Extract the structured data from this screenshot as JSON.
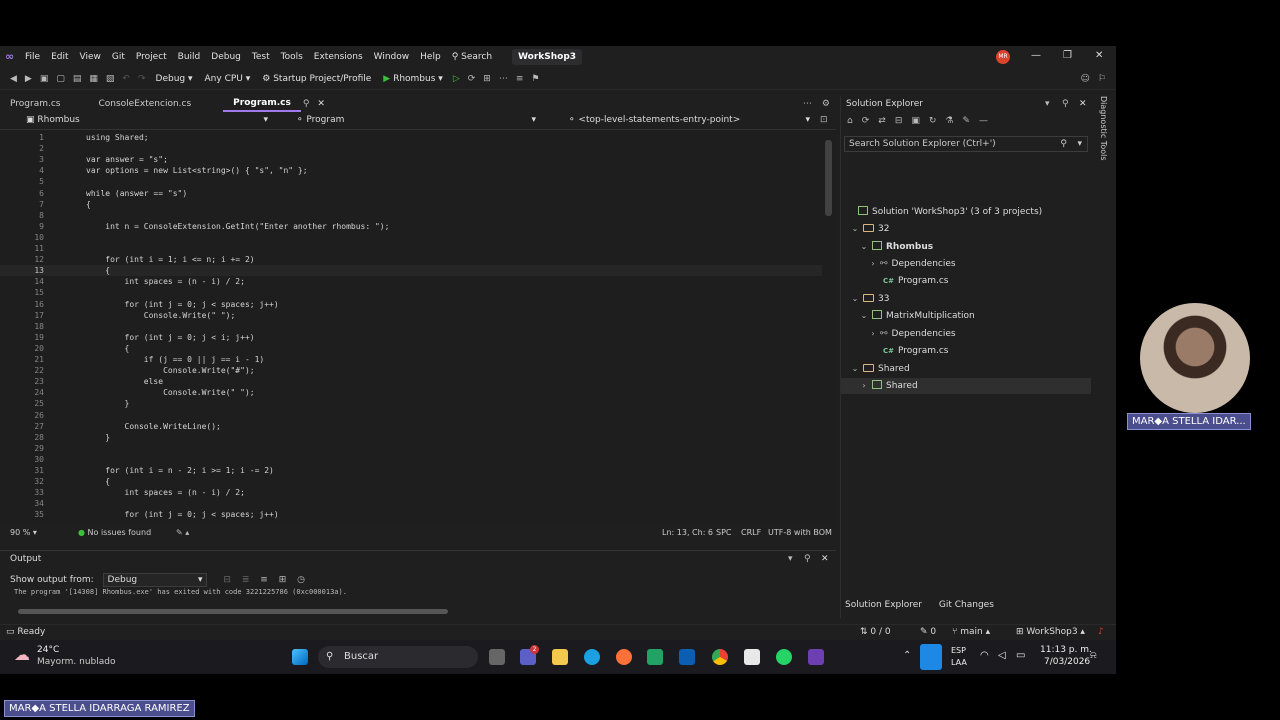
{
  "menubar": {
    "items": [
      "File",
      "Edit",
      "View",
      "Git",
      "Project",
      "Build",
      "Debug",
      "Test",
      "Tools",
      "Extensions",
      "Window",
      "Help"
    ],
    "search_label": "Search",
    "window_title": "WorkShop3",
    "avatar_initials": "MR"
  },
  "toolbar": {
    "config": "Debug",
    "platform": "Any CPU",
    "startup": "Startup Project/Profile",
    "run_label": "Rhombus"
  },
  "tabs": [
    {
      "label": "Program.cs",
      "active": false
    },
    {
      "label": "ConsoleExtencion.cs",
      "active": false
    },
    {
      "label": "Program.cs",
      "active": true
    }
  ],
  "navbar": {
    "project": "Rhombus",
    "type": "Program",
    "member": "<top-level-statements-entry-point>"
  },
  "code": {
    "current_line": 13,
    "lines": [
      {
        "n": "1",
        "text": "using Shared;"
      },
      {
        "n": "2",
        "text": ""
      },
      {
        "n": "3",
        "text": "var answer = \"s\";"
      },
      {
        "n": "4",
        "text": "var options = new List<string>() { \"s\", \"n\" };"
      },
      {
        "n": "5",
        "text": ""
      },
      {
        "n": "6",
        "text": "while (answer == \"s\")"
      },
      {
        "n": "7",
        "text": "{"
      },
      {
        "n": "8",
        "text": ""
      },
      {
        "n": "9",
        "text": "    int n = ConsoleExtension.GetInt(\"Enter another rhombus: \");"
      },
      {
        "n": "10",
        "text": ""
      },
      {
        "n": "11",
        "text": ""
      },
      {
        "n": "12",
        "text": "    for (int i = 1; i <= n; i += 2)"
      },
      {
        "n": "13",
        "text": "    {"
      },
      {
        "n": "14",
        "text": "        int spaces = (n - i) / 2;"
      },
      {
        "n": "15",
        "text": ""
      },
      {
        "n": "16",
        "text": "        for (int j = 0; j < spaces; j++)"
      },
      {
        "n": "17",
        "text": "            Console.Write(\" \");"
      },
      {
        "n": "18",
        "text": ""
      },
      {
        "n": "19",
        "text": "        for (int j = 0; j < i; j++)"
      },
      {
        "n": "20",
        "text": "        {"
      },
      {
        "n": "21",
        "text": "            if (j == 0 || j == i - 1)"
      },
      {
        "n": "22",
        "text": "                Console.Write(\"#\");"
      },
      {
        "n": "23",
        "text": "            else"
      },
      {
        "n": "24",
        "text": "                Console.Write(\" \");"
      },
      {
        "n": "25",
        "text": "        }"
      },
      {
        "n": "26",
        "text": ""
      },
      {
        "n": "27",
        "text": "        Console.WriteLine();"
      },
      {
        "n": "28",
        "text": "    }"
      },
      {
        "n": "29",
        "text": ""
      },
      {
        "n": "30",
        "text": ""
      },
      {
        "n": "31",
        "text": "    for (int i = n - 2; i >= 1; i -= 2)"
      },
      {
        "n": "32",
        "text": "    {"
      },
      {
        "n": "33",
        "text": "        int spaces = (n - i) / 2;"
      },
      {
        "n": "34",
        "text": ""
      },
      {
        "n": "35",
        "text": "        for (int j = 0; j < spaces; j++)"
      }
    ]
  },
  "editor_status": {
    "zoom": "90 %",
    "issues": "No issues found",
    "position": "Ln: 13, Ch: 6",
    "whitespace": "SPC",
    "line_ending": "CRLF",
    "encoding": "UTF-8 with BOM"
  },
  "output": {
    "title": "Output",
    "show_from_label": "Show output from:",
    "show_from_value": "Debug",
    "text": "The program '[14308] Rhombus.exe' has exited with code 3221225786 (0xc000013a)."
  },
  "statusbar": {
    "ready": "Ready",
    "sync": "0 / 0",
    "pending": "0",
    "branch": "main",
    "repo": "WorkShop3"
  },
  "solution_explorer": {
    "title": "Solution Explorer",
    "search_placeholder": "Search Solution Explorer (Ctrl+')",
    "solution_label": "Solution 'WorkShop3' (3 of 3 projects)",
    "folder_32": "32",
    "project_rhombus": "Rhombus",
    "dependencies": "Dependencies",
    "program_cs": "Program.cs",
    "folder_33": "33",
    "project_matrix": "MatrixMultiplication",
    "folder_shared": "Shared",
    "project_shared": "Shared",
    "tab_solex": "Solution Explorer",
    "tab_git": "Git Changes"
  },
  "diagnostic_tools": "Diagnostic Tools",
  "taskbar": {
    "temp": "24°C",
    "weather": "Mayorm. nublado",
    "search": "Buscar",
    "lang1": "ESP",
    "lang2": "LAA",
    "time": "11:13 p. m.",
    "date": "7/03/2026",
    "teams_badge": "2"
  },
  "webcam_name": "MAR◆A STELLA IDAR...",
  "bottom_name": "MAR◆A STELLA IDARRAGA RAMIREZ"
}
